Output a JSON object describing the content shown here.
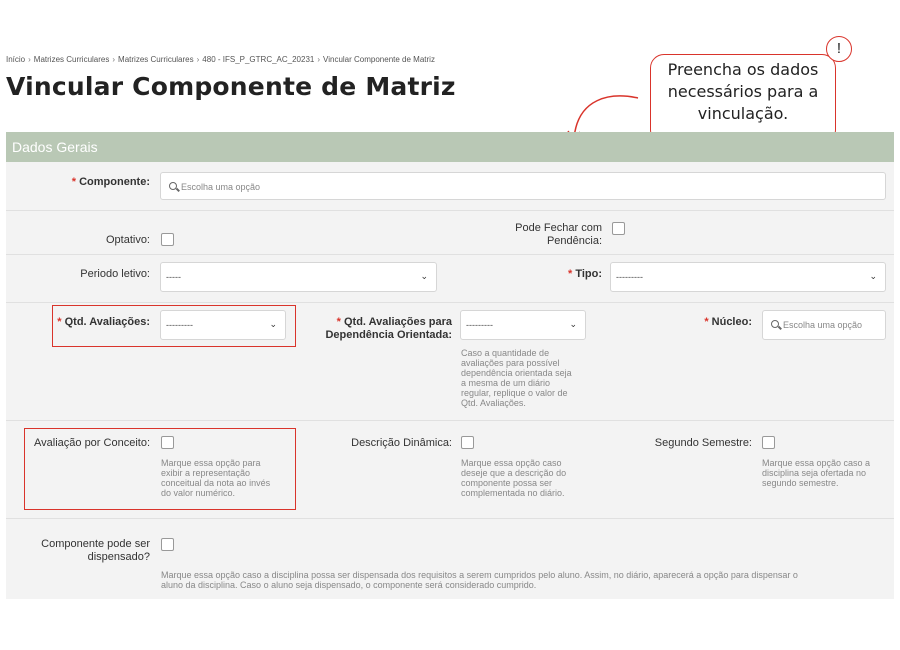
{
  "breadcrumb": {
    "items": [
      "Início",
      "Matrizes Curriculares",
      "Matrizes Curriculares",
      "480 - IFS_P_GTRC_AC_20231",
      "Vincular Componente de Matriz"
    ],
    "separator": "›"
  },
  "page_title": "Vincular Componente de Matriz",
  "callout": {
    "lines": [
      "Preencha os dados",
      "necessários para a",
      "vinculação."
    ],
    "badge": "!"
  },
  "panel": {
    "header": "Dados Gerais",
    "required_mark": "*",
    "componente": {
      "label": "Componente:",
      "placeholder": "Escolha uma opção"
    },
    "optativo": {
      "label": "Optativo:",
      "checked": false
    },
    "pode_fechar": {
      "label_line1": "Pode Fechar com",
      "label_line2": "Pendência:",
      "checked": false
    },
    "periodo_letivo": {
      "label": "Periodo letivo:",
      "value": "-----"
    },
    "tipo": {
      "label": "Tipo:",
      "value": "---------"
    },
    "qtd_avaliacoes": {
      "label": "Qtd. Avaliações:",
      "value": "---------"
    },
    "qtd_avaliacoes_dep": {
      "label_line1": "Qtd. Avaliações para",
      "label_line2": "Dependência Orientada:",
      "value": "---------",
      "help": [
        "Caso a quantidade de",
        "avaliações para possível",
        "dependência orientada seja",
        "a mesma de um diário",
        "regular, replique o valor de",
        "Qtd. Avaliações."
      ]
    },
    "nucleo": {
      "label": "Núcleo:",
      "placeholder": "Escolha uma opção"
    },
    "avaliacao_conceito": {
      "label": "Avaliação por Conceito:",
      "checked": false,
      "help": [
        "Marque essa opção para",
        "exibir a representação",
        "conceitual da nota ao invés",
        "do valor numérico."
      ]
    },
    "descricao_dinamica": {
      "label": "Descrição Dinâmica:",
      "checked": false,
      "help": [
        "Marque essa opção caso",
        "deseje que a descrição do",
        "componente possa ser",
        "complementada no diário."
      ]
    },
    "segundo_semestre": {
      "label": "Segundo Semestre:",
      "checked": false,
      "help": [
        "Marque essa opção caso a",
        "disciplina seja ofertada no",
        "segundo semestre."
      ]
    },
    "dispensado": {
      "label_line1": "Componente pode ser",
      "label_line2": "dispensado?",
      "checked": false,
      "help": [
        "Marque essa opção caso a disciplina possa ser dispensada dos requisitos a serem cumpridos pelo aluno. Assim, no diário, aparecerá a opção para dispensar o",
        "aluno da disciplina. Caso o aluno seja dispensado, o componente será considerado cumprido."
      ]
    }
  },
  "colors": {
    "header_bg": "#b9c8b5",
    "panel_bg": "#f3f3f3",
    "required": "#d9342b",
    "highlight": "#d9342b"
  },
  "icons": [
    "search-icon",
    "chevron-down-icon",
    "curved-arrow-icon",
    "exclamation-icon"
  ]
}
